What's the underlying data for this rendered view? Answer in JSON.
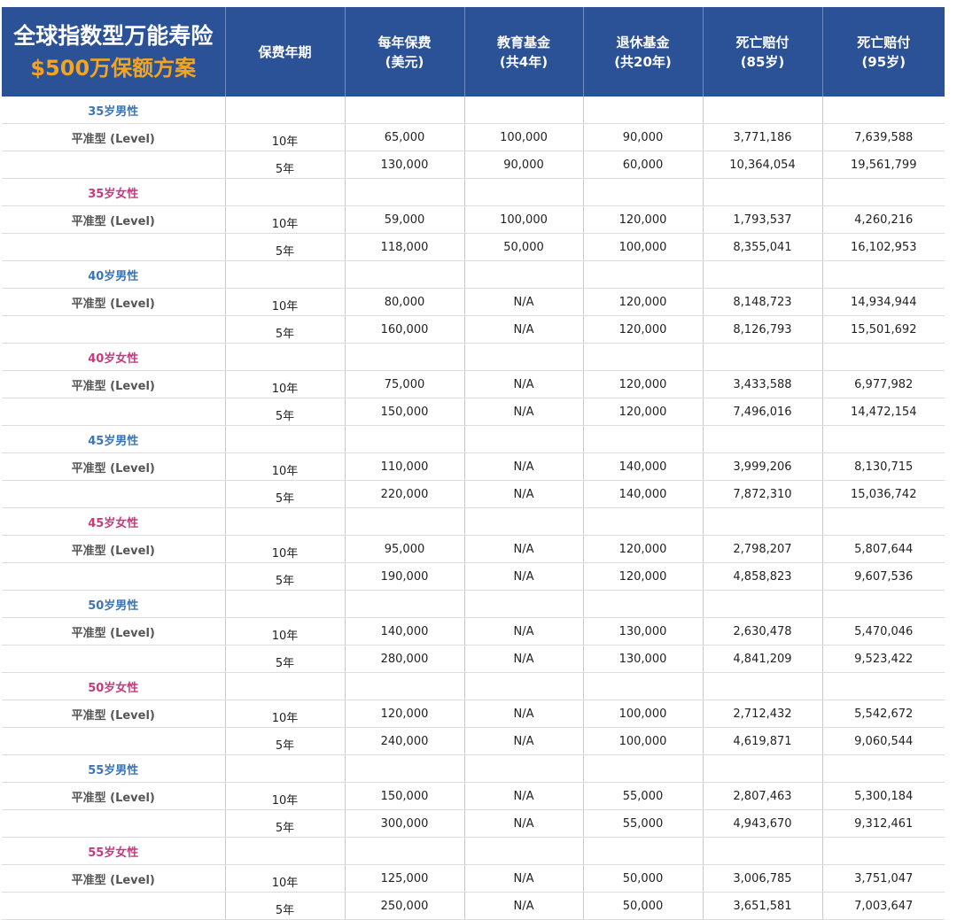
{
  "title": {
    "line1": "全球指数型万能寿险",
    "line2": "$500万保额方案"
  },
  "columns": [
    {
      "line1": "保费年期",
      "line2": ""
    },
    {
      "line1": "每年保费",
      "line2": "(美元)"
    },
    {
      "line1": "教育基金",
      "line2": "(共4年)"
    },
    {
      "line1": "退休基金",
      "line2": "(共20年)"
    },
    {
      "line1": "死亡赔付",
      "line2": "(85岁)"
    },
    {
      "line1": "死亡赔付",
      "line2": "(95岁)"
    }
  ],
  "groups": [
    {
      "label": "35岁男性",
      "gender": "male",
      "rows": [
        {
          "type": "平准型 (Level)",
          "term": "10年",
          "premium": "65,000",
          "edu": "100,000",
          "retire": "90,000",
          "d85": "3,771,186",
          "d95": "7,639,588"
        },
        {
          "type": "",
          "term": "5年",
          "premium": "130,000",
          "edu": "90,000",
          "retire": "60,000",
          "d85": "10,364,054",
          "d95": "19,561,799"
        }
      ]
    },
    {
      "label": "35岁女性",
      "gender": "female",
      "rows": [
        {
          "type": "平准型 (Level)",
          "term": "10年",
          "premium": "59,000",
          "edu": "100,000",
          "retire": "120,000",
          "d85": "1,793,537",
          "d95": "4,260,216"
        },
        {
          "type": "",
          "term": "5年",
          "premium": "118,000",
          "edu": "50,000",
          "retire": "100,000",
          "d85": "8,355,041",
          "d95": "16,102,953"
        }
      ]
    },
    {
      "label": "40岁男性",
      "gender": "male",
      "rows": [
        {
          "type": "平准型 (Level)",
          "term": "10年",
          "premium": "80,000",
          "edu": "N/A",
          "retire": "120,000",
          "d85": "8,148,723",
          "d95": "14,934,944"
        },
        {
          "type": "",
          "term": "5年",
          "premium": "160,000",
          "edu": "N/A",
          "retire": "120,000",
          "d85": "8,126,793",
          "d95": "15,501,692"
        }
      ]
    },
    {
      "label": "40岁女性",
      "gender": "female",
      "rows": [
        {
          "type": "平准型 (Level)",
          "term": "10年",
          "premium": "75,000",
          "edu": "N/A",
          "retire": "120,000",
          "d85": "3,433,588",
          "d95": "6,977,982"
        },
        {
          "type": "",
          "term": "5年",
          "premium": "150,000",
          "edu": "N/A",
          "retire": "120,000",
          "d85": "7,496,016",
          "d95": "14,472,154"
        }
      ]
    },
    {
      "label": "45岁男性",
      "gender": "male",
      "rows": [
        {
          "type": "平准型 (Level)",
          "term": "10年",
          "premium": "110,000",
          "edu": "N/A",
          "retire": "140,000",
          "d85": "3,999,206",
          "d95": "8,130,715"
        },
        {
          "type": "",
          "term": "5年",
          "premium": "220,000",
          "edu": "N/A",
          "retire": "140,000",
          "d85": "7,872,310",
          "d95": "15,036,742"
        }
      ]
    },
    {
      "label": "45岁女性",
      "gender": "female",
      "rows": [
        {
          "type": "平准型 (Level)",
          "term": "10年",
          "premium": "95,000",
          "edu": "N/A",
          "retire": "120,000",
          "d85": "2,798,207",
          "d95": "5,807,644"
        },
        {
          "type": "",
          "term": "5年",
          "premium": "190,000",
          "edu": "N/A",
          "retire": "120,000",
          "d85": "4,858,823",
          "d95": "9,607,536"
        }
      ]
    },
    {
      "label": "50岁男性",
      "gender": "male",
      "rows": [
        {
          "type": "平准型 (Level)",
          "term": "10年",
          "premium": "140,000",
          "edu": "N/A",
          "retire": "130,000",
          "d85": "2,630,478",
          "d95": "5,470,046"
        },
        {
          "type": "",
          "term": "5年",
          "premium": "280,000",
          "edu": "N/A",
          "retire": "130,000",
          "d85": "4,841,209",
          "d95": "9,523,422"
        }
      ]
    },
    {
      "label": "50岁女性",
      "gender": "female",
      "rows": [
        {
          "type": "平准型 (Level)",
          "term": "10年",
          "premium": "120,000",
          "edu": "N/A",
          "retire": "100,000",
          "d85": "2,712,432",
          "d95": "5,542,672"
        },
        {
          "type": "",
          "term": "5年",
          "premium": "240,000",
          "edu": "N/A",
          "retire": "100,000",
          "d85": "4,619,871",
          "d95": "9,060,544"
        }
      ]
    },
    {
      "label": "55岁男性",
      "gender": "male",
      "rows": [
        {
          "type": "平准型 (Level)",
          "term": "10年",
          "premium": "150,000",
          "edu": "N/A",
          "retire": "55,000",
          "d85": "2,807,463",
          "d95": "5,300,184"
        },
        {
          "type": "",
          "term": "5年",
          "premium": "300,000",
          "edu": "N/A",
          "retire": "55,000",
          "d85": "4,943,670",
          "d95": "9,312,461"
        }
      ]
    },
    {
      "label": "55岁女性",
      "gender": "female",
      "rows": [
        {
          "type": "平准型 (Level)",
          "term": "10年",
          "premium": "125,000",
          "edu": "N/A",
          "retire": "50,000",
          "d85": "3,006,785",
          "d95": "3,751,047"
        },
        {
          "type": "",
          "term": "5年",
          "premium": "250,000",
          "edu": "N/A",
          "retire": "50,000",
          "d85": "3,651,581",
          "d95": "7,003,647"
        }
      ]
    }
  ],
  "colors": {
    "header_bg": "#2b5196",
    "title_accent": "#f2a523",
    "male_label": "#3d74b6",
    "female_label": "#c43a7d"
  }
}
